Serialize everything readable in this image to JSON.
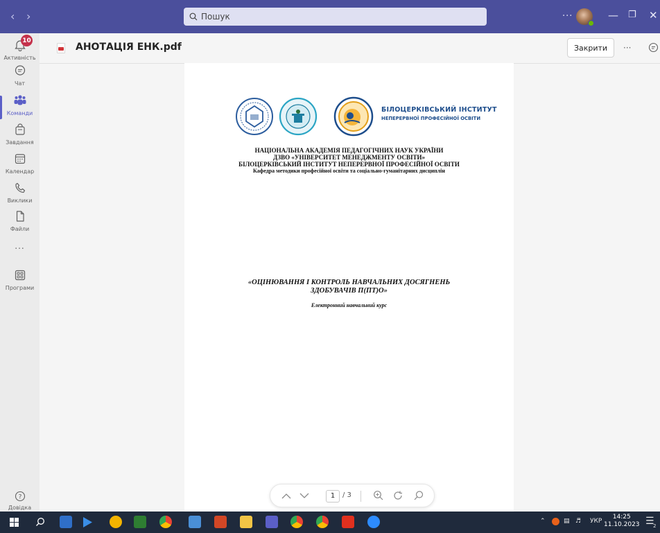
{
  "titlebar": {
    "search_placeholder": "Пошук",
    "more_label": "···"
  },
  "rail": {
    "activity_badge": "10",
    "items": [
      {
        "label": "Активність"
      },
      {
        "label": "Чат"
      },
      {
        "label": "Команди"
      },
      {
        "label": "Завдання"
      },
      {
        "label": "Календар"
      },
      {
        "label": "Виклики"
      },
      {
        "label": "Файли"
      },
      {
        "label": "..."
      },
      {
        "label": "Програми"
      }
    ],
    "help_label": "Довідка"
  },
  "header": {
    "file_name": "АНОТАЦІЯ ЕНК.pdf",
    "close_label": "Закрити",
    "more_label": "···"
  },
  "document": {
    "logo_title": "БІЛОЦЕРКІВСЬКИЙ ІНСТИТУТ",
    "logo_subtitle": "НЕПЕРЕРВНОЇ ПРОФЕСІЙНОЇ ОСВІТИ",
    "org_lines": [
      "НАЦІОНАЛЬНА АКАДЕМІЯ ПЕДАГОГІЧНИХ НАУК УКРАЇНИ",
      "ДЗВО «УНІВЕРСИТЕТ МЕНЕДЖМЕНТУ ОСВІТИ»",
      "БІЛОЦЕРКІВСЬКИЙ ІНСТИТУТ НЕПЕРЕРВНОЇ ПРОФЕСІЙНОЇ ОСВІТИ",
      "Кафедра методики професійної освіти та соціально-гуманітарних дисциплін"
    ],
    "course_title_1": "«ОЦІНЮВАННЯ І КОНТРОЛЬ НАВЧАЛЬНИХ ДОСЯГНЕНЬ",
    "course_title_2": "ЗДОБУВАЧІВ П(ПТ)О»",
    "course_type": "Електронний навчальний курс"
  },
  "pager": {
    "current_page": "1",
    "total": "/ 3"
  },
  "taskbar": {
    "language": "УКР",
    "time": "14:25",
    "date": "11.10.2023",
    "notification_count": "2"
  },
  "colors": {
    "titlebar": "#4b4f9c",
    "accent": "#5b5fc7",
    "badge": "#c4314b",
    "taskbar": "#1f2a3c"
  }
}
